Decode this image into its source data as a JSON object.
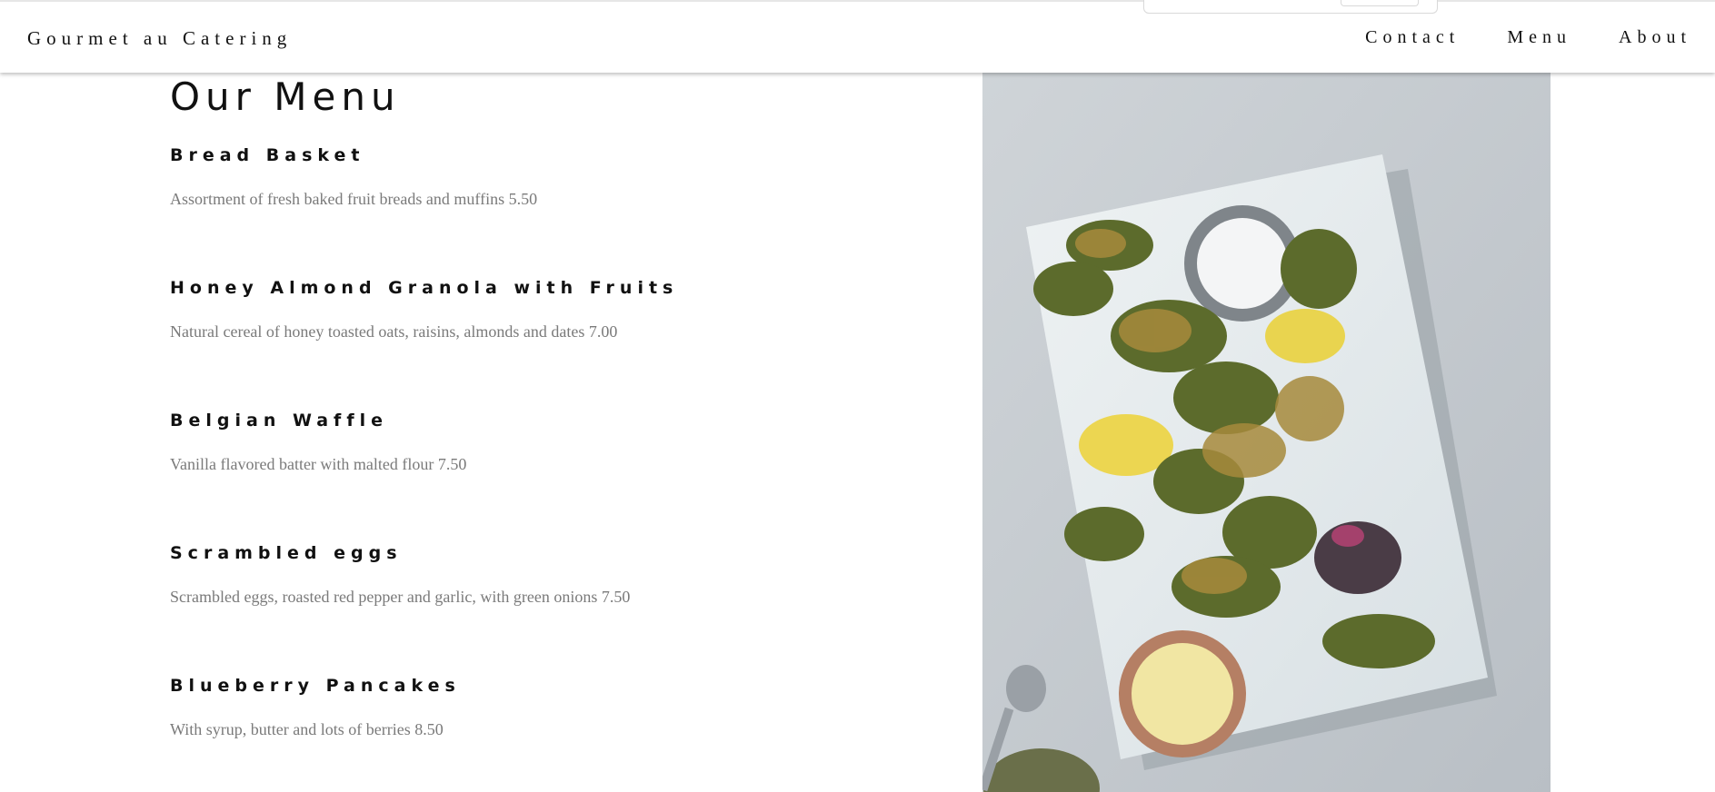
{
  "header": {
    "brand": "Gourmet au Catering",
    "nav": [
      "Contact",
      "Menu",
      "About"
    ]
  },
  "main": {
    "title": "Our Menu",
    "items": [
      {
        "name": "Bread Basket",
        "description": "Assortment of fresh baked fruit breads and muffins 5.50"
      },
      {
        "name": "Honey Almond Granola with Fruits",
        "description": "Natural cereal of honey toasted oats, raisins, almonds and dates 7.00"
      },
      {
        "name": "Belgian Waffle",
        "description": "Vanilla flavored batter with malted flour 7.50"
      },
      {
        "name": "Scrambled eggs",
        "description": "Scrambled eggs, roasted red pepper and garlic, with green onions 7.50"
      },
      {
        "name": "Blueberry Pancakes",
        "description": "With syrup, butter and lots of berries 8.50"
      }
    ]
  },
  "colors": {
    "text": "#111111",
    "description": "#7a7a7a",
    "photo_background": "#c9ced3"
  }
}
